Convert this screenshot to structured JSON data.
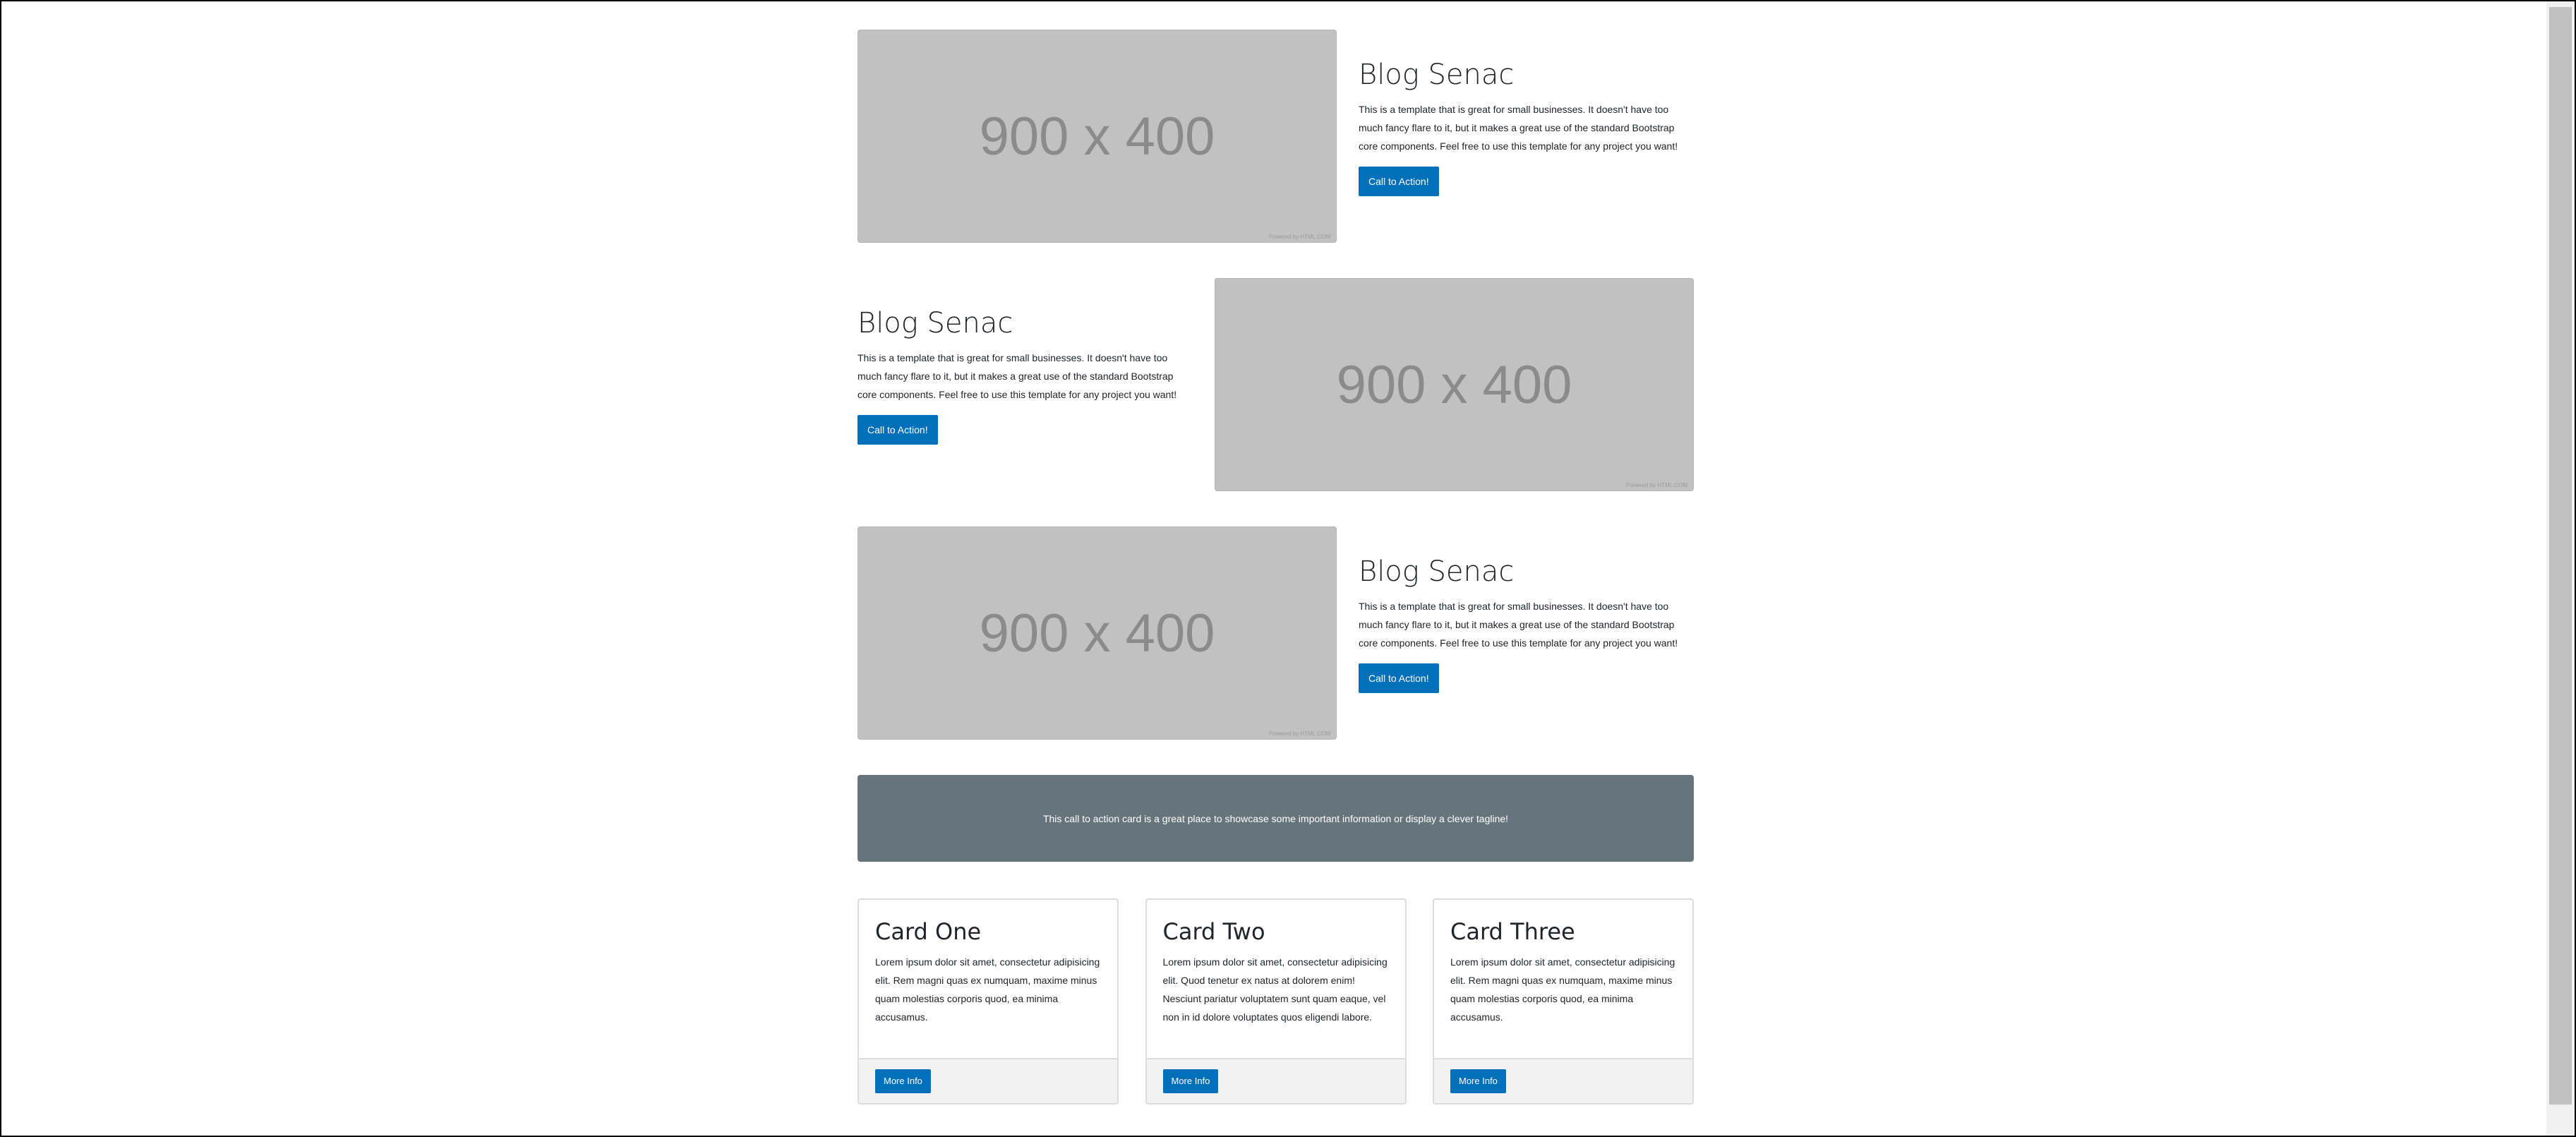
{
  "features": [
    {
      "image_label": "900 x 400",
      "image_credit": "Powered by HTML.COM",
      "title": "Blog Senac",
      "body": "This is a template that is great for small businesses. It doesn't have too much fancy flare to it, but it makes a great use of the standard Bootstrap core components. Feel free to use this template for any project you want!",
      "button_label": "Call to Action!"
    },
    {
      "image_label": "900 x 400",
      "image_credit": "Powered by HTML.COM",
      "title": "Blog Senac",
      "body": "This is a template that is great for small businesses. It doesn't have too much fancy flare to it, but it makes a great use of the standard Bootstrap core components. Feel free to use this template for any project you want!",
      "button_label": "Call to Action!"
    },
    {
      "image_label": "900 x 400",
      "image_credit": "Powered by HTML.COM",
      "title": "Blog Senac",
      "body": "This is a template that is great for small businesses. It doesn't have too much fancy flare to it, but it makes a great use of the standard Bootstrap core components. Feel free to use this template for any project you want!",
      "button_label": "Call to Action!"
    }
  ],
  "cta": {
    "text": "This call to action card is a great place to showcase some important information or display a clever tagline!"
  },
  "cards": [
    {
      "title": "Card One",
      "text": "Lorem ipsum dolor sit amet, consectetur adipisicing elit. Rem magni quas ex numquam, maxime minus quam molestias corporis quod, ea minima accusamus.",
      "button_label": "More Info"
    },
    {
      "title": "Card Two",
      "text": "Lorem ipsum dolor sit amet, consectetur adipisicing elit. Quod tenetur ex natus at dolorem enim! Nesciunt pariatur voluptatem sunt quam eaque, vel non in id dolore voluptates quos eligendi labore.",
      "button_label": "More Info"
    },
    {
      "title": "Card Three",
      "text": "Lorem ipsum dolor sit amet, consectetur adipisicing elit. Rem magni quas ex numquam, maxime minus quam molestias corporis quod, ea minima accusamus.",
      "button_label": "More Info"
    }
  ],
  "colors": {
    "primary_button": "#0070bb",
    "cta_background": "#66757c",
    "placeholder_background": "#c1c1c1"
  }
}
